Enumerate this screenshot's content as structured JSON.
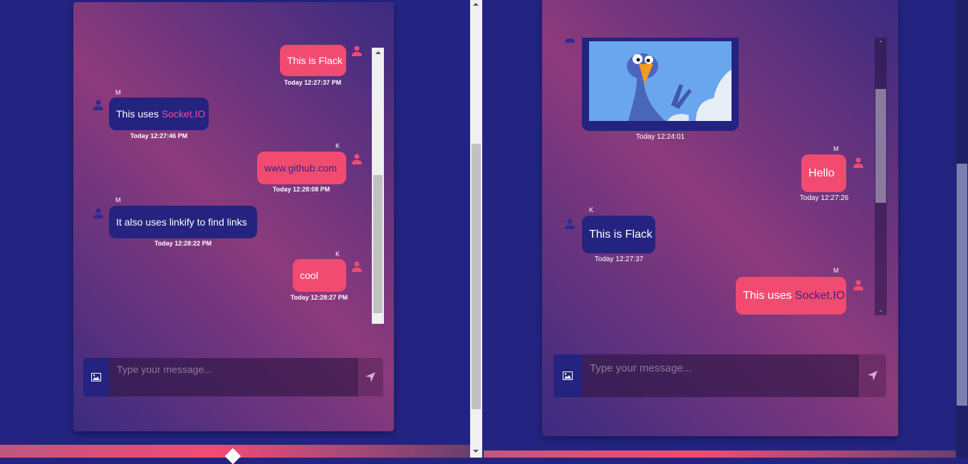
{
  "left_window": {
    "messages": [
      {
        "sender": "",
        "text": "This is Flack",
        "timestamp": "Today 12:27:37 PM",
        "side": "sent"
      },
      {
        "sender": "M",
        "text": "This uses ",
        "link": "Socket.IO",
        "timestamp": "Today 12:27:46 PM",
        "side": "received"
      },
      {
        "sender": "K",
        "text": "",
        "link": "www.github.com",
        "timestamp": "Today 12:28:08 PM",
        "side": "sent"
      },
      {
        "sender": "M",
        "text": "It also uses linkify to find links",
        "timestamp": "Today 12:28:22 PM",
        "side": "received"
      },
      {
        "sender": "K",
        "text": "cool",
        "timestamp": "Today 12:28:27 PM",
        "side": "sent"
      }
    ],
    "input": {
      "placeholder": "Type your message..."
    }
  },
  "right_window": {
    "messages": [
      {
        "type": "image",
        "image": "bird-cartoon",
        "timestamp": "Today 12:24:01",
        "side": "received"
      },
      {
        "sender": "M",
        "text": "Hello",
        "timestamp": "Today 12:27:26",
        "side": "sent"
      },
      {
        "sender": "K",
        "text": "This is Flack",
        "timestamp": "Today 12:27:37",
        "side": "received"
      },
      {
        "sender": "M",
        "text": "This uses ",
        "link": "Socket.IO",
        "side": "sent"
      }
    ],
    "input": {
      "placeholder": "Type your message..."
    }
  },
  "colors": {
    "sent": "#f24b72",
    "received": "#24237f",
    "background": "#232482"
  }
}
